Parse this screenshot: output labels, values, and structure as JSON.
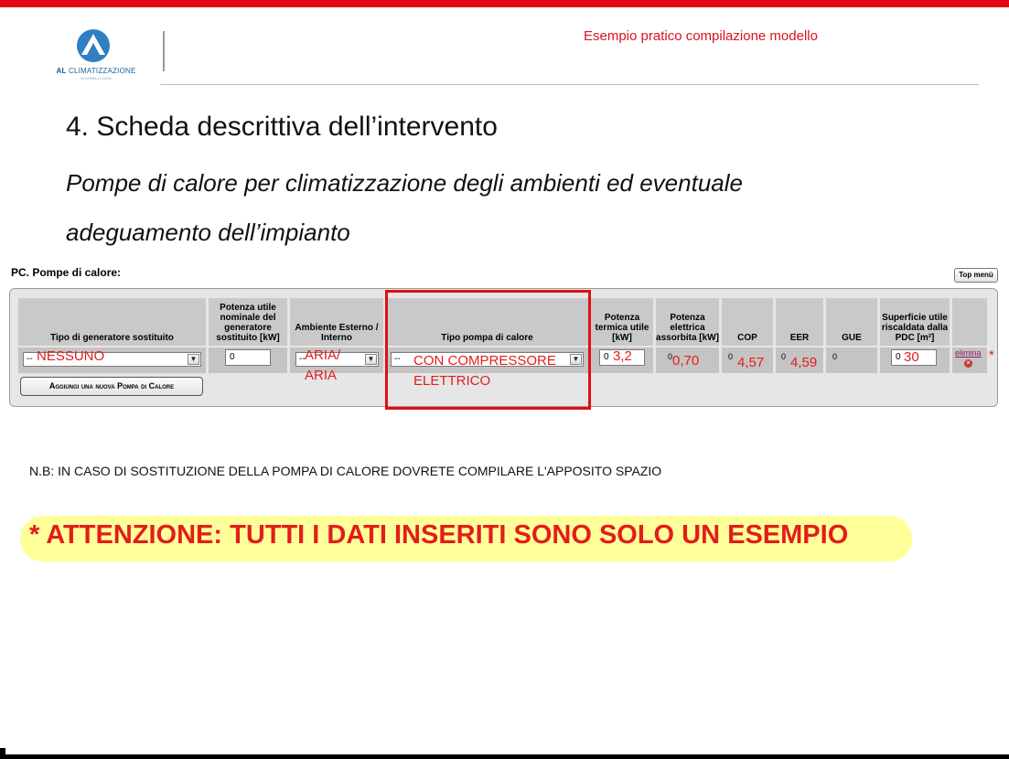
{
  "header": {
    "logo_brand_bold": "AL",
    "logo_brand": "CLIMATIZZAZIONE",
    "logo_sub": "DI AGNELLI LUCA",
    "caption": "Esempio pratico compilazione modello"
  },
  "slide": {
    "title": "4. Scheda descrittiva dell’intervento",
    "subtitle_line1": "Pompe di calore per climatizzazione degli ambienti ed eventuale",
    "subtitle_line2": "adeguamento dell’impianto"
  },
  "form": {
    "section_label": "PC. Pompe di calore:",
    "top_menu_label": "Top menù",
    "columns": [
      "Tipo di generatore sostituito",
      "Potenza utile nominale del generatore sostituito [kW]",
      "Ambiente Esterno / Interno",
      "Tipo pompa di calore",
      "Potenza termica utile [kW]",
      "Potenza elettrica assorbita [kW]",
      "COP",
      "EER",
      "GUE",
      "Superficie utile riscaldata dalla PDC [m²]"
    ],
    "row": {
      "generatore_select": "--",
      "generatore_overlay": "NESSUNO",
      "potenza_nominale": "0",
      "ambiente_select": "--",
      "ambiente_overlay_1": "ARIA/",
      "ambiente_overlay_2": "ARIA",
      "tipo_pompa_select": "--",
      "tipo_pompa_overlay_1": "CON COMPRESSORE",
      "tipo_pompa_overlay_2": "ELETTRICO",
      "potenza_termica_field": "0",
      "potenza_termica_overlay": "3,2",
      "potenza_elettrica_field": "0",
      "potenza_elettrica_overlay": "0,70",
      "cop_field": "0",
      "cop_overlay": "4,57",
      "eer_field": "0",
      "eer_overlay": "4,59",
      "gue_field": "0",
      "superficie_field": "0",
      "superficie_overlay": "30",
      "elimina_label": "elimina",
      "asterisk": "*"
    },
    "add_button_label": "Aggiungi una nuova Pompa di Calore"
  },
  "note": "N.B: IN CASO DI SOSTITUZIONE DELLA POMPA DI CALORE DOVRETE  COMPILARE L'APPOSITO SPAZIO",
  "banner": "* ATTENZIONE: TUTTI I DATI INSERITI SONO SOLO UN ESEMPIO",
  "colors": {
    "accent_red": "#e30613",
    "annotation_red": "#e31c1c",
    "banner_yellow": "#ffff99",
    "logo_blue": "#1f5fa0"
  }
}
